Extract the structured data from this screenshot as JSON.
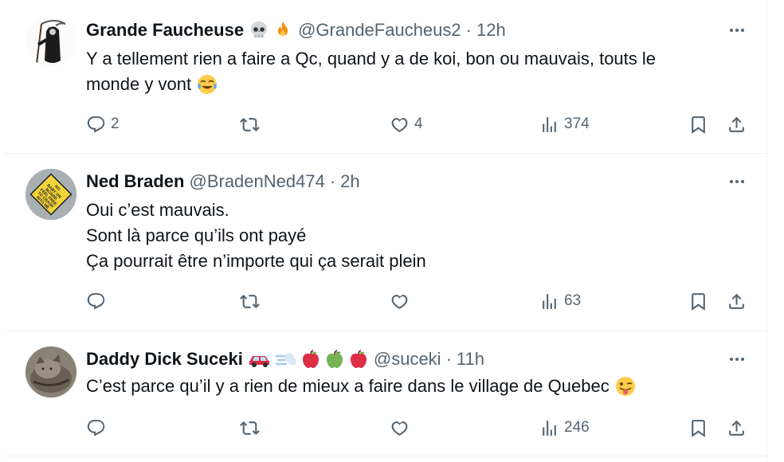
{
  "colors": {
    "text": "#0f1419",
    "muted": "#536471",
    "divider": "#eff3f4"
  },
  "posts": [
    {
      "author": "Grande Faucheuse",
      "name_emojis": [
        "skull-emoji",
        "fire-emoji"
      ],
      "handle": "@GrandeFaucheus2",
      "separator": "·",
      "time": "12h",
      "lines": [
        "Y a tellement rien a faire a Qc, quand y a de koi, bon ou mauvais, touts le",
        "monde y vont"
      ],
      "text_emoji": "face-with-tears-of-joy-emoji",
      "replies": "2",
      "reposts": "",
      "likes": "4",
      "views": "374"
    },
    {
      "author": "Ned Braden",
      "name_emojis": [],
      "handle": "@BradenNed474",
      "separator": "·",
      "time": "2h",
      "lines": [
        "Oui c’est mauvais.",
        "Sont là parce qu’ils ont payé",
        "Ça pourrait être n’importe qui ça serait plein"
      ],
      "avatar_sign": [
        "NO",
        "BABY ON",
        "BOARD",
        "FEEL FREE",
        "TO CRASH",
        "INTO ME"
      ],
      "replies": "",
      "reposts": "",
      "likes": "",
      "views": "63"
    },
    {
      "author": "Daddy Dick Suceki",
      "name_emojis": [
        "car-emoji",
        "dash-emoji",
        "red-apple-emoji",
        "green-apple-emoji",
        "red-apple-emoji"
      ],
      "handle": "@suceki",
      "separator": "·",
      "time": "11h",
      "lines": [
        "C’est parce qu’il y a rien de mieux a faire dans le village de Quebec"
      ],
      "text_emoji": "winking-face-with-tongue-emoji",
      "replies": "",
      "reposts": "",
      "likes": "",
      "views": "246"
    }
  ]
}
